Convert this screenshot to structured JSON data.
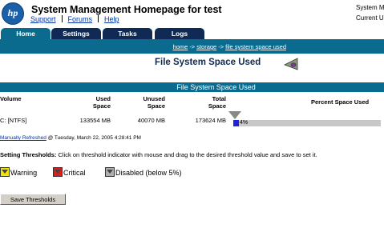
{
  "header": {
    "logo_text": "hp",
    "title": "System Management Homepage for test",
    "links": [
      "Support",
      "Forums",
      "Help"
    ],
    "sys_info": [
      "System M",
      "Current U"
    ]
  },
  "tabs": [
    {
      "label": "Home",
      "active": true
    },
    {
      "label": "Settings",
      "active": false
    },
    {
      "label": "Tasks",
      "active": false
    },
    {
      "label": "Logs",
      "active": false
    }
  ],
  "breadcrumb": [
    "home",
    "storage",
    "file system space used"
  ],
  "page_title": "File System Space Used",
  "section_title": "File System Space Used",
  "table": {
    "columns": {
      "volume": "Volume",
      "used": [
        "Used",
        "Space"
      ],
      "unused": [
        "Unused",
        "Space"
      ],
      "total": [
        "Total",
        "Space"
      ],
      "percent": "Percent Space Used"
    },
    "rows": [
      {
        "volume": "C: [NTFS]",
        "used": "133554 MB",
        "unused": "40070 MB",
        "total": "173624 MB",
        "percent_label": "4%",
        "percent_value": 4
      }
    ]
  },
  "refresh": {
    "link": "Manually Refreshed",
    "text": "@ Tuesday, March 22, 2005 4:28:41 PM"
  },
  "thresholds": {
    "label": "Setting Thresholds:",
    "text": "Click on threshold indicator with mouse and drag to the desired threshold value and save to set it.",
    "legend": [
      {
        "label": "Warning",
        "color": "#f2e600"
      },
      {
        "label": "Critical",
        "color": "#e01b1b"
      },
      {
        "label": "Disabled (below 5%)",
        "color": "#b0b0b0"
      }
    ],
    "save_label": "Save Thresholds"
  },
  "colors": {
    "brand": "#0a6b8f",
    "tab_dark": "#0e2a55",
    "bar": "#1e22d8"
  }
}
